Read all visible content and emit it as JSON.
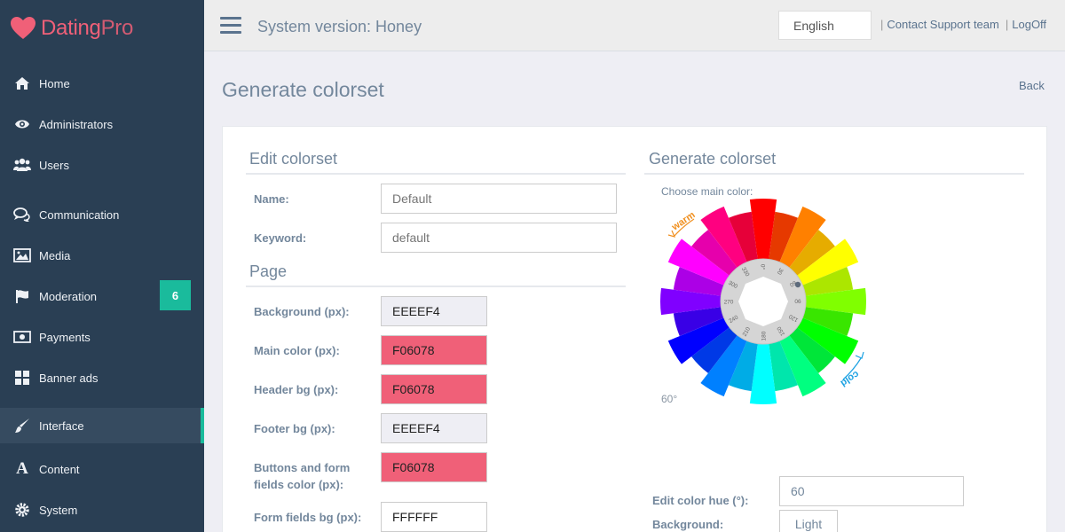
{
  "brand": {
    "name_main": "Dating",
    "name_suffix": "Pro",
    "color": "#f06078"
  },
  "sidebar": {
    "items": [
      {
        "label": "Home",
        "icon": "home-icon"
      },
      {
        "label": "Administrators",
        "icon": "eye-icon"
      },
      {
        "label": "Users",
        "icon": "users-icon"
      },
      {
        "label": "Communication",
        "icon": "chat-icon"
      },
      {
        "label": "Media",
        "icon": "image-icon"
      },
      {
        "label": "Moderation",
        "icon": "flag-icon",
        "badge": "6"
      },
      {
        "label": "Payments",
        "icon": "money-icon"
      },
      {
        "label": "Banner ads",
        "icon": "grid-icon"
      },
      {
        "label": "Interface",
        "icon": "brush-icon",
        "active": true
      },
      {
        "label": "Content",
        "icon": "font-icon"
      },
      {
        "label": "System",
        "icon": "gear-icon"
      }
    ]
  },
  "topbar": {
    "system_version": "System version: Honey",
    "language": "English",
    "support_link": "Contact Support team",
    "logoff_link": "LogOff"
  },
  "page": {
    "title": "Generate colorset",
    "back_label": "Back"
  },
  "edit_section": {
    "title": "Edit colorset",
    "name_label": "Name:",
    "name_placeholder": "Default",
    "keyword_label": "Keyword:",
    "keyword_placeholder": "default"
  },
  "page_section": {
    "title": "Page",
    "fields": [
      {
        "label": "Background (px):",
        "value": "EEEEF4",
        "color": "#eeeef4"
      },
      {
        "label": "Main color (px):",
        "value": "F06078",
        "color": "#f06078"
      },
      {
        "label": "Header bg (px):",
        "value": "F06078",
        "color": "#f06078"
      },
      {
        "label": "Footer bg (px):",
        "value": "EEEEF4",
        "color": "#eeeef4"
      },
      {
        "label": "Buttons and form fields color (px):",
        "value": "F06078",
        "color": "#f06078"
      },
      {
        "label": "Form fields bg (px):",
        "value": "FFFFFF",
        "color": "#ffffff"
      }
    ]
  },
  "generate_section": {
    "title": "Generate colorset",
    "choose_label": "Choose main color:",
    "degree_readout": "60°",
    "warm_label": "warm",
    "cold_label": "cold",
    "dial_ticks": [
      "0°",
      "30",
      "60",
      "90",
      "120",
      "150",
      "180",
      "210",
      "240",
      "270",
      "300",
      "330"
    ],
    "hue_label": "Edit color hue (°):",
    "hue_value": "60",
    "background_label": "Background:",
    "background_option": "Light"
  }
}
